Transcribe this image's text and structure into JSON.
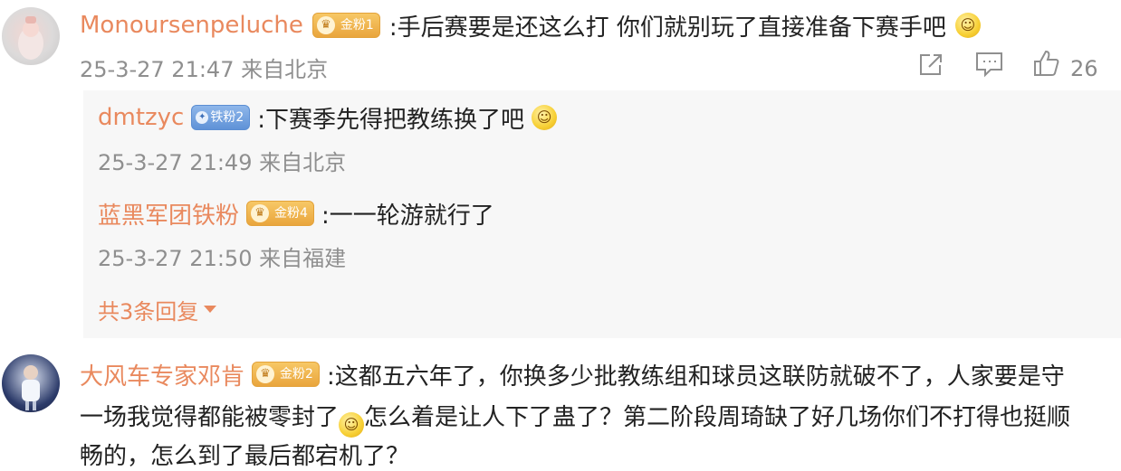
{
  "comments": [
    {
      "username": "Monoursenpeluche",
      "badge": "金粉1",
      "text": ":手后赛要是还这么打 你们就别玩了直接准备下赛手吧",
      "timestamp": "25-3-27 21:47 来自北京",
      "like_count": "26",
      "replies": [
        {
          "username": "dmtzyc",
          "badge": "铁粉2",
          "text": ":下赛季先得把教练换了吧",
          "timestamp": "25-3-27 21:49 来自北京"
        },
        {
          "username": "蓝黑军团铁粉",
          "badge": "金粉4",
          "text": ":一一轮游就行了",
          "timestamp": "25-3-27 21:50 来自福建"
        }
      ],
      "more_replies_label": "共3条回复"
    },
    {
      "username": "大风车专家邓肯",
      "badge": "金粉2",
      "text_line1": ":这都五六年了，你换多少批教练组和球员这联防就破不了，人家要是守",
      "text_line2a": "一场我觉得都能被零封了",
      "text_line2b": "怎么着是让人下了蛊了？第二阶段周琦缺了好几场你们不打得也挺顺",
      "text_line3": "畅的，怎么到了最后都宕机了？"
    }
  ],
  "icons": {
    "share": "share-icon",
    "comment": "comment-icon",
    "like": "thumbs-up-icon",
    "dropdown": "caret-down-icon"
  },
  "colors": {
    "username": "#e9895e",
    "meta": "#8f8f8f",
    "reply_bg": "#f7f7f7",
    "gold_badge": "#f0b54e",
    "iron_badge": "#6f9fdf"
  }
}
